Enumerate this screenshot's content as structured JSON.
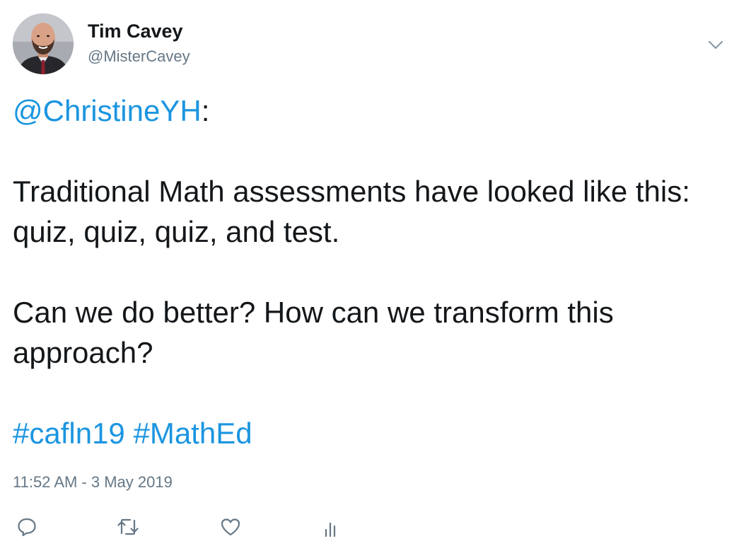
{
  "author": {
    "name": "Tim Cavey",
    "handle": "@MisterCavey"
  },
  "tweet": {
    "mention": "@ChristineYH",
    "mention_suffix": ":",
    "paragraph_1": "Traditional Math assessments have looked like this: quiz, quiz, quiz, and test.",
    "paragraph_2": "Can we do better? How can we transform this approach?",
    "hashtags": [
      "#cafln19",
      "#MathEd"
    ],
    "timestamp": "11:52 AM - 3 May 2019"
  },
  "icons": {
    "menu": "chevron-down-icon",
    "reply": "reply-icon",
    "retweet": "retweet-icon",
    "like": "heart-icon",
    "analytics": "analytics-icon"
  },
  "colors": {
    "link": "#1b95e0",
    "text": "#14171a",
    "secondary": "#657786"
  }
}
